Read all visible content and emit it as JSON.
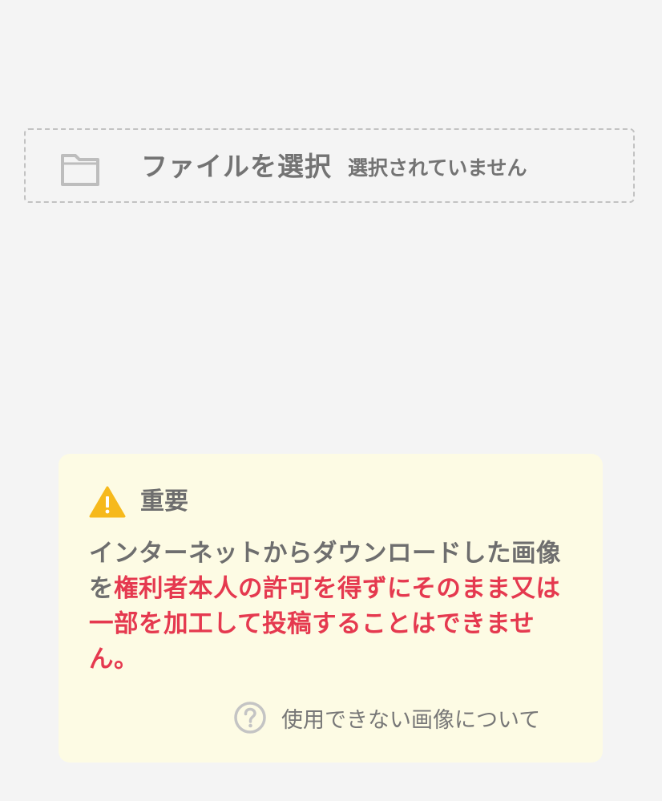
{
  "file_input": {
    "button_label": "ファイルを選択",
    "status_text": "選択されていません",
    "icon": "folder-icon"
  },
  "notice": {
    "icon": "warning-icon",
    "title": "重要",
    "body_normal": "インターネットからダウンロードした画像を",
    "body_emphasis": "権利者本人の許可を得ずにそのまま又は一部を加工して投稿することはできません。",
    "help_icon": "question-circle-icon",
    "help_link": "使用できない画像について"
  },
  "colors": {
    "background": "#f4f4f4",
    "notice_background": "#fdfbe4",
    "warning_yellow": "#f6b91c",
    "emphasis_red": "#e5394f",
    "text_gray": "#6e6e6e"
  }
}
